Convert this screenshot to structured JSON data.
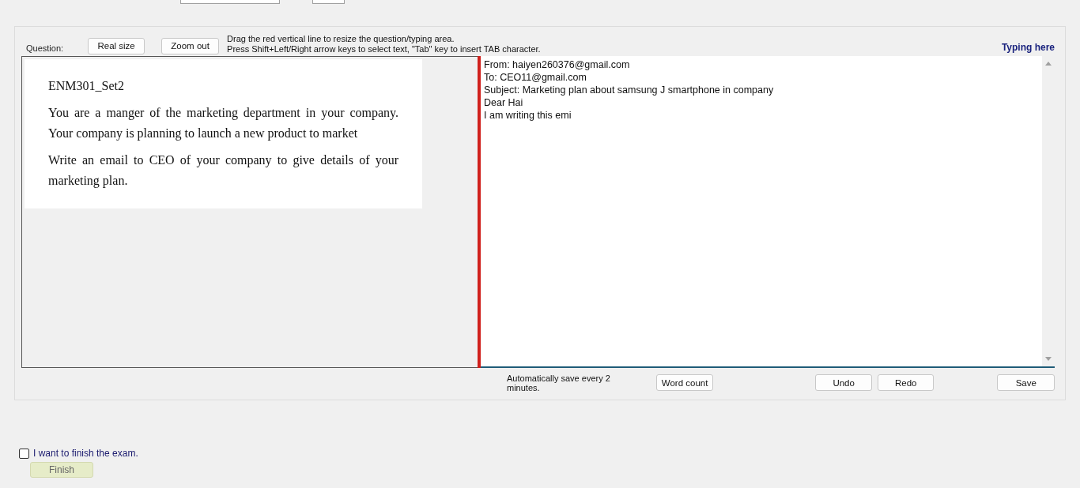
{
  "toolbar": {
    "question_label": "Question:",
    "buttons": [
      "Real size",
      "Zoom out"
    ],
    "hints": [
      "Drag the red vertical line to resize the question/typing area.",
      "Press Shift+Left/Right arrow keys to select text, \"Tab\" key to insert TAB character."
    ],
    "typing_label": "Typing here"
  },
  "question": {
    "title": "ENM301_Set2",
    "paragraphs": [
      "You are a manger of the marketing department in your company. Your company is planning to launch a new product to market",
      "Write an email to CEO of your company to give details of your marketing plan."
    ]
  },
  "answer": {
    "lines": [
      "From: haiyen260376@gmail.com",
      "To: CEO11@gmail.com",
      "Subject: Marketing plan about samsung J smartphone in company",
      "Dear Hai",
      "I am writing this emi"
    ]
  },
  "footer": {
    "autosave": "Automatically save every 2 minutes.",
    "word_count": "Word count",
    "undo": "Undo",
    "redo": "Redo",
    "save": "Save"
  },
  "finish": {
    "label": "I want to finish the exam.",
    "checked": false,
    "button": "Finish"
  }
}
